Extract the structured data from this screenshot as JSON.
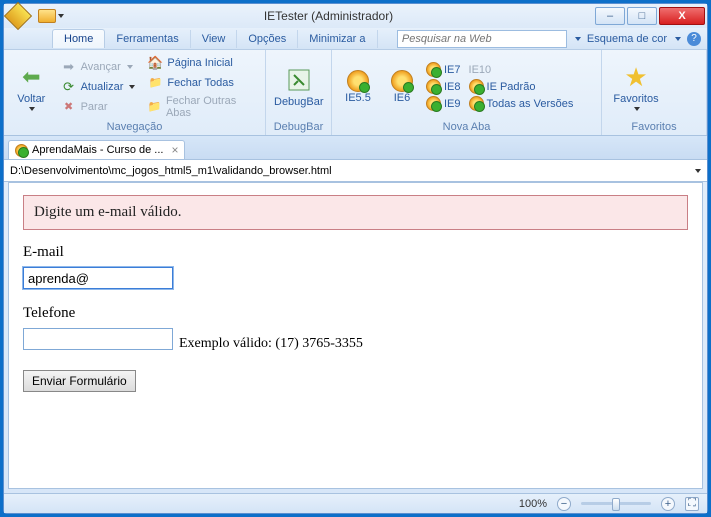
{
  "window": {
    "title": "IETester (Administrador)"
  },
  "titlebar_menu": {
    "minimize": "–",
    "maximize": "□",
    "close": "X"
  },
  "ribbon_tabs": {
    "home": "Home",
    "ferramentas": "Ferramentas",
    "view": "View",
    "opcoes": "Opções",
    "minimizar": "Minimizar a"
  },
  "search": {
    "placeholder": "Pesquisar na Web"
  },
  "scheme": {
    "label": "Esquema de cor"
  },
  "nav": {
    "voltar": "Voltar",
    "avancar": "Avançar",
    "atualizar": "Atualizar",
    "parar": "Parar",
    "pagina_inicial": "Página Inicial",
    "fechar_todas": "Fechar Todas",
    "fechar_outras": "Fechar Outras Abas",
    "group": "Navegação"
  },
  "debugbar": {
    "label": "DebugBar",
    "group": "DebugBar"
  },
  "newtab": {
    "ie55": "IE5.5",
    "ie6": "IE6",
    "ie7": "IE7",
    "ie8": "IE8",
    "ie9": "IE9",
    "ie10": "IE10",
    "padrao": "IE Padrão",
    "todas": "Todas as Versões",
    "group": "Nova Aba"
  },
  "favorites": {
    "label": "Favoritos",
    "group": "Favoritos"
  },
  "pagetab": {
    "title": "AprendaMais - Curso de ..."
  },
  "address": "D:\\Desenvolvimento\\mc_jogos_html5_m1\\validando_browser.html",
  "page": {
    "error": "Digite um e-mail válido.",
    "email_label": "E-mail",
    "email_value": "aprenda@",
    "phone_label": "Telefone",
    "phone_hint": "Exemplo válido: (17) 3765-3355",
    "submit": "Enviar Formulário"
  },
  "status": {
    "zoom": "100%"
  }
}
